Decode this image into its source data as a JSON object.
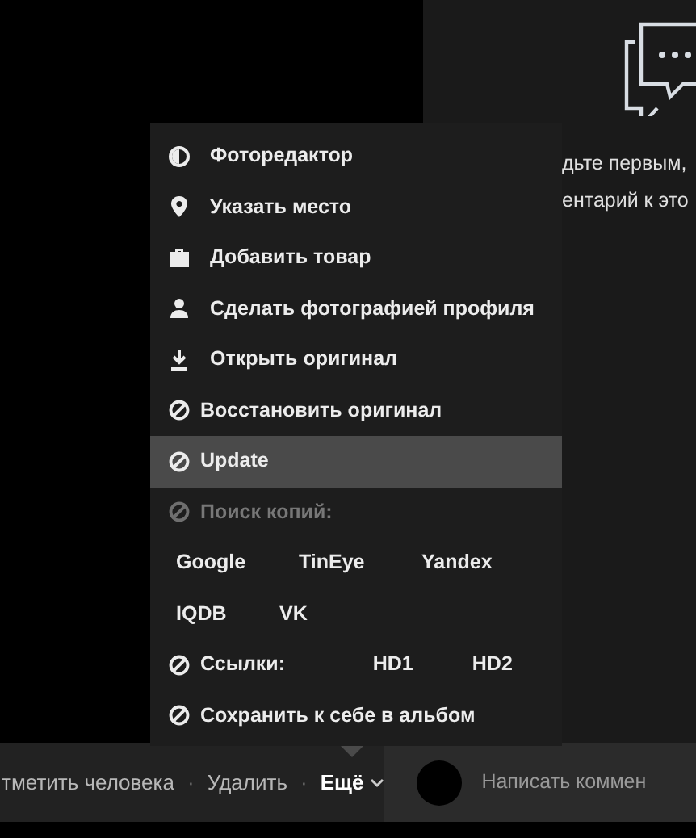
{
  "comments_panel": {
    "lines": [
      "дьте первым,",
      "ентарий к это"
    ]
  },
  "menu": {
    "items": [
      {
        "kind": "action",
        "label": "Фоторедактор",
        "selected": false,
        "disabled": false
      },
      {
        "kind": "action",
        "label": "Указать место",
        "selected": false,
        "disabled": false
      },
      {
        "kind": "action",
        "label": "Добавить товар",
        "selected": false,
        "disabled": false
      },
      {
        "kind": "action",
        "label": "Сделать фотографией профиля",
        "selected": false,
        "disabled": false
      },
      {
        "kind": "action",
        "label": "Открыть оригинал",
        "selected": false,
        "disabled": false
      },
      {
        "kind": "ban",
        "label": "Восстановить оригинал",
        "selected": false,
        "disabled": false
      },
      {
        "kind": "ban",
        "label": "Update",
        "selected": true,
        "disabled": false
      },
      {
        "kind": "ban",
        "label": "Поиск копий:",
        "selected": false,
        "disabled": true
      },
      {
        "kind": "links",
        "links": [
          "Google",
          "TinEye",
          "Yandex"
        ],
        "selected": false,
        "disabled": false
      },
      {
        "kind": "links",
        "links": [
          "IQDB",
          "VK"
        ],
        "selected": false,
        "disabled": false
      },
      {
        "kind": "ban",
        "label": "Ссылки:",
        "links": [
          "HD1",
          "HD2"
        ],
        "selected": false,
        "disabled": false
      },
      {
        "kind": "ban",
        "label": "Сохранить к себе в альбом",
        "selected": false,
        "disabled": false
      }
    ]
  },
  "action_bar": [
    {
      "kind": "link",
      "label": "тметить человека"
    },
    {
      "kind": "dot",
      "label": "·"
    },
    {
      "kind": "link",
      "label": "Удалить"
    },
    {
      "kind": "dot",
      "label": "·"
    },
    {
      "kind": "dropdown",
      "label": "Ещё"
    }
  ],
  "comment_field": {
    "placeholder": "Написать коммен"
  }
}
